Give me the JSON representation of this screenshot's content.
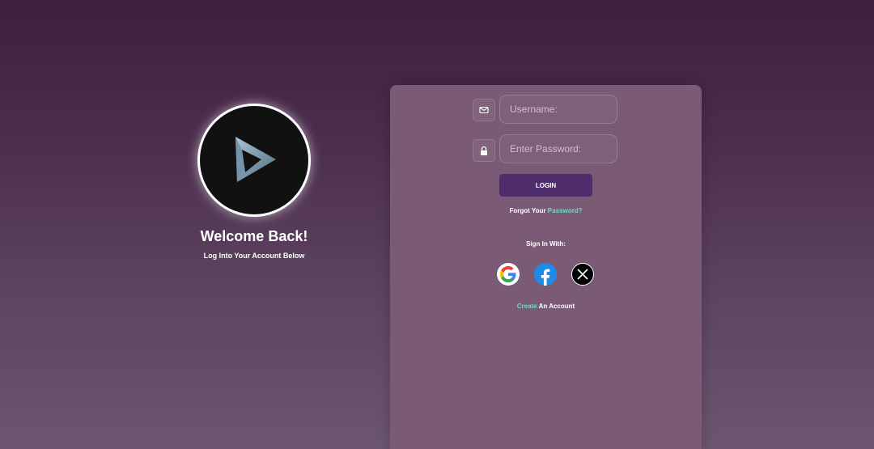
{
  "brand": {
    "welcome": "Welcome Back!",
    "subtitle": "Log Into Your Account Below"
  },
  "form": {
    "username_placeholder": "Username:",
    "password_placeholder": "Enter Password:",
    "login_label": "LOGIN",
    "forgot_prefix": "Forgot Your ",
    "forgot_link": "Password?",
    "sign_in_with": "Sign In With:",
    "create_link": "Create",
    "create_suffix": " An Account"
  },
  "icons": {
    "username": "mail-icon",
    "password": "lock-icon",
    "social": [
      "google-icon",
      "facebook-icon",
      "x-icon"
    ],
    "logo": "play-logo"
  },
  "colors": {
    "accent": "#5ee3c0",
    "button": "#4f2d6c",
    "panel": "#7a5a74"
  }
}
